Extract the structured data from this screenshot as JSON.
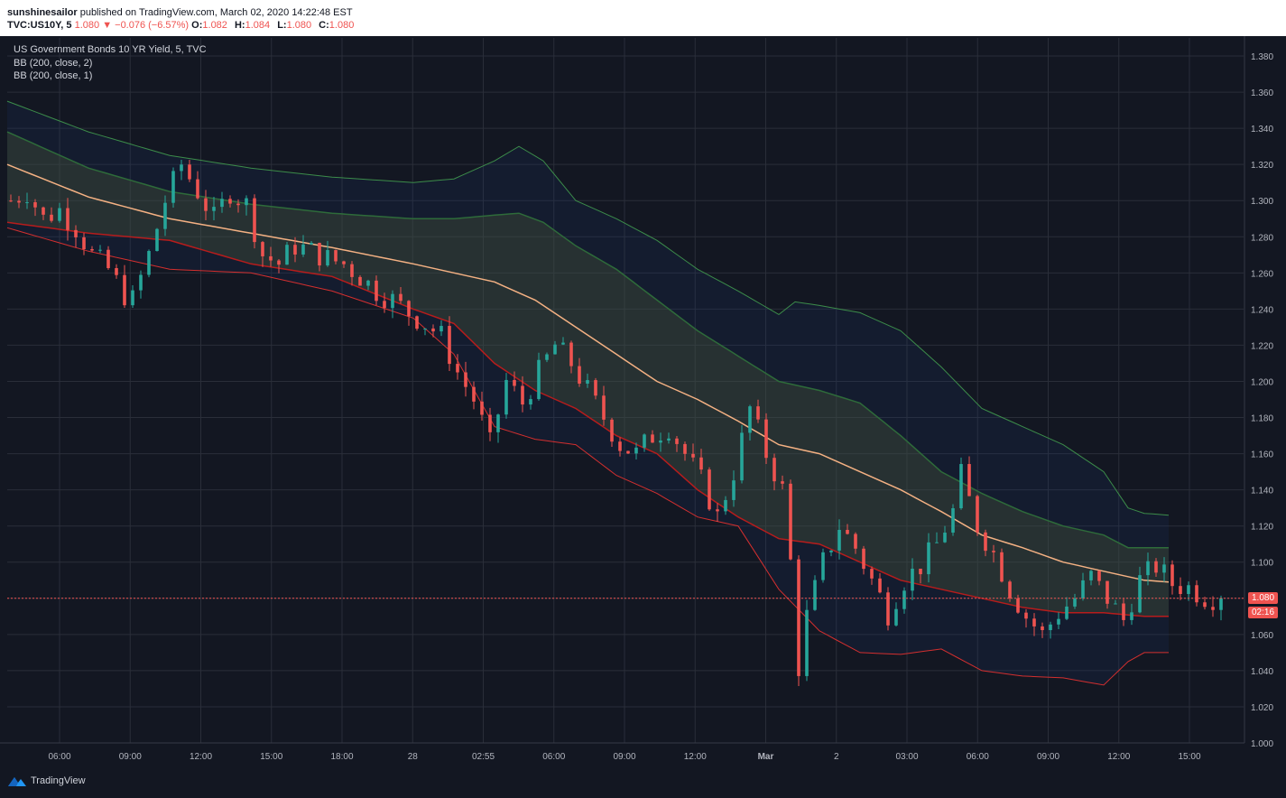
{
  "header": {
    "author": "sunshinesailor",
    "published_text": "published on TradingView.com, March 02, 2020 14:22:48 EST",
    "symbol_line": "TVC:US10Y, 5",
    "last": "1.080",
    "arrow": "▼",
    "change": "−0.076 (−6.57%)",
    "o_label": "O:",
    "o_value": "1.082",
    "h_label": "H:",
    "h_value": "1.084",
    "l_label": "L:",
    "l_value": "1.080",
    "c_label": "C:",
    "c_value": "1.080"
  },
  "legend": {
    "title": "US Government Bonds 10 YR Yield, 5, TVC",
    "bb1": "BB (200, close, 2)",
    "bb2": "BB (200, close, 1)"
  },
  "price_tag": {
    "value": "1.080",
    "countdown": "02:16"
  },
  "brand": {
    "label": "TradingView",
    "icon": "tradingview-logo-icon"
  },
  "colors": {
    "background": "#131722",
    "up": "#26a69a",
    "down": "#ef5350",
    "basis": "#f4b183",
    "upper_band": "#3c8c4a",
    "lower_band": "#d32f2f",
    "grid": "#2a2e39"
  },
  "chart_data": {
    "type": "candlestick",
    "title": "US Government Bonds 10 YR Yield, 5, TVC",
    "ylim": [
      1.0,
      1.39
    ],
    "y_ticks": [
      "1.000",
      "1.020",
      "1.040",
      "1.060",
      "1.080",
      "1.100",
      "1.120",
      "1.140",
      "1.160",
      "1.180",
      "1.200",
      "1.220",
      "1.240",
      "1.260",
      "1.280",
      "1.300",
      "1.320",
      "1.340",
      "1.360",
      "1.380"
    ],
    "x_ticks": [
      "06:00",
      "09:00",
      "12:00",
      "15:00",
      "18:00",
      "28",
      "02:55",
      "06:00",
      "09:00",
      "12:00",
      "Mar",
      "2",
      "03:00",
      "06:00",
      "09:00",
      "12:00",
      "15:00"
    ],
    "current_price": 1.08,
    "price_path": [
      [
        0,
        1.3
      ],
      [
        2,
        1.305
      ],
      [
        4,
        1.29
      ],
      [
        6,
        1.295
      ],
      [
        8,
        1.285
      ],
      [
        10,
        1.27
      ],
      [
        12,
        1.262
      ],
      [
        14,
        1.248
      ],
      [
        15,
        1.245
      ],
      [
        17,
        1.27
      ],
      [
        19,
        1.3
      ],
      [
        21,
        1.32
      ],
      [
        23,
        1.305
      ],
      [
        25,
        1.29
      ],
      [
        27,
        1.305
      ],
      [
        29,
        1.298
      ],
      [
        31,
        1.27
      ],
      [
        33,
        1.265
      ],
      [
        35,
        1.275
      ],
      [
        37,
        1.272
      ],
      [
        39,
        1.268
      ],
      [
        41,
        1.265
      ],
      [
        43,
        1.258
      ],
      [
        45,
        1.25
      ],
      [
        47,
        1.245
      ],
      [
        49,
        1.238
      ],
      [
        51,
        1.232
      ],
      [
        53,
        1.225
      ],
      [
        55,
        1.205
      ],
      [
        57,
        1.19
      ],
      [
        59,
        1.165
      ],
      [
        61,
        1.2
      ],
      [
        63,
        1.188
      ],
      [
        65,
        1.205
      ],
      [
        67,
        1.22
      ],
      [
        69,
        1.21
      ],
      [
        71,
        1.195
      ],
      [
        73,
        1.18
      ],
      [
        75,
        1.165
      ],
      [
        77,
        1.16
      ],
      [
        79,
        1.17
      ],
      [
        81,
        1.175
      ],
      [
        83,
        1.16
      ],
      [
        85,
        1.145
      ],
      [
        87,
        1.125
      ],
      [
        89,
        1.15
      ],
      [
        91,
        1.185
      ],
      [
        93,
        1.16
      ],
      [
        95,
        1.14
      ],
      [
        96,
        1.1
      ],
      [
        97,
        1.042
      ],
      [
        98,
        1.07
      ],
      [
        100,
        1.1
      ],
      [
        102,
        1.12
      ],
      [
        104,
        1.108
      ],
      [
        106,
        1.09
      ],
      [
        108,
        1.072
      ],
      [
        110,
        1.09
      ],
      [
        112,
        1.098
      ],
      [
        114,
        1.11
      ],
      [
        116,
        1.128
      ],
      [
        117,
        1.148
      ],
      [
        119,
        1.12
      ],
      [
        121,
        1.105
      ],
      [
        123,
        1.085
      ],
      [
        125,
        1.07
      ],
      [
        127,
        1.06
      ],
      [
        129,
        1.072
      ],
      [
        131,
        1.08
      ],
      [
        133,
        1.092
      ],
      [
        135,
        1.08
      ],
      [
        137,
        1.068
      ],
      [
        139,
        1.09
      ],
      [
        141,
        1.098
      ],
      [
        143,
        1.088
      ],
      [
        145,
        1.086
      ],
      [
        147,
        1.081
      ],
      [
        149,
        1.08
      ]
    ],
    "series": [
      {
        "name": "BB (200, close, 2)",
        "band": "upper",
        "values": [
          [
            0,
            1.355
          ],
          [
            10,
            1.338
          ],
          [
            20,
            1.325
          ],
          [
            30,
            1.318
          ],
          [
            40,
            1.313
          ],
          [
            50,
            1.31
          ],
          [
            55,
            1.312
          ],
          [
            60,
            1.322
          ],
          [
            63,
            1.33
          ],
          [
            66,
            1.322
          ],
          [
            70,
            1.3
          ],
          [
            75,
            1.29
          ],
          [
            80,
            1.278
          ],
          [
            85,
            1.262
          ],
          [
            90,
            1.25
          ],
          [
            95,
            1.237
          ],
          [
            97,
            1.244
          ],
          [
            100,
            1.242
          ],
          [
            105,
            1.238
          ],
          [
            110,
            1.228
          ],
          [
            115,
            1.208
          ],
          [
            120,
            1.185
          ],
          [
            125,
            1.175
          ],
          [
            130,
            1.165
          ],
          [
            135,
            1.15
          ],
          [
            138,
            1.13
          ],
          [
            140,
            1.127
          ],
          [
            143,
            1.126
          ]
        ]
      },
      {
        "name": "BB (200, close, 1)",
        "band": "upper",
        "values": [
          [
            0,
            1.338
          ],
          [
            10,
            1.318
          ],
          [
            20,
            1.305
          ],
          [
            30,
            1.298
          ],
          [
            40,
            1.293
          ],
          [
            50,
            1.29
          ],
          [
            55,
            1.29
          ],
          [
            60,
            1.292
          ],
          [
            63,
            1.293
          ],
          [
            66,
            1.288
          ],
          [
            70,
            1.275
          ],
          [
            75,
            1.262
          ],
          [
            80,
            1.245
          ],
          [
            85,
            1.228
          ],
          [
            90,
            1.214
          ],
          [
            95,
            1.2
          ],
          [
            100,
            1.195
          ],
          [
            105,
            1.188
          ],
          [
            110,
            1.17
          ],
          [
            115,
            1.15
          ],
          [
            120,
            1.138
          ],
          [
            125,
            1.128
          ],
          [
            130,
            1.12
          ],
          [
            135,
            1.115
          ],
          [
            138,
            1.108
          ],
          [
            143,
            1.108
          ]
        ]
      },
      {
        "name": "Basis",
        "band": "basis",
        "values": [
          [
            0,
            1.32
          ],
          [
            10,
            1.302
          ],
          [
            20,
            1.29
          ],
          [
            30,
            1.282
          ],
          [
            40,
            1.274
          ],
          [
            50,
            1.265
          ],
          [
            55,
            1.26
          ],
          [
            60,
            1.255
          ],
          [
            65,
            1.245
          ],
          [
            70,
            1.23
          ],
          [
            75,
            1.215
          ],
          [
            80,
            1.2
          ],
          [
            85,
            1.19
          ],
          [
            90,
            1.178
          ],
          [
            95,
            1.165
          ],
          [
            100,
            1.16
          ],
          [
            105,
            1.15
          ],
          [
            110,
            1.14
          ],
          [
            115,
            1.128
          ],
          [
            120,
            1.115
          ],
          [
            125,
            1.108
          ],
          [
            130,
            1.1
          ],
          [
            135,
            1.095
          ],
          [
            140,
            1.09
          ],
          [
            143,
            1.089
          ]
        ]
      },
      {
        "name": "BB (200, close, 1)",
        "band": "lower",
        "values": [
          [
            0,
            1.288
          ],
          [
            10,
            1.282
          ],
          [
            20,
            1.278
          ],
          [
            30,
            1.265
          ],
          [
            40,
            1.258
          ],
          [
            50,
            1.24
          ],
          [
            55,
            1.232
          ],
          [
            60,
            1.21
          ],
          [
            65,
            1.195
          ],
          [
            70,
            1.185
          ],
          [
            75,
            1.17
          ],
          [
            80,
            1.16
          ],
          [
            85,
            1.14
          ],
          [
            90,
            1.125
          ],
          [
            95,
            1.113
          ],
          [
            100,
            1.11
          ],
          [
            105,
            1.1
          ],
          [
            110,
            1.09
          ],
          [
            115,
            1.085
          ],
          [
            120,
            1.08
          ],
          [
            125,
            1.075
          ],
          [
            130,
            1.072
          ],
          [
            135,
            1.072
          ],
          [
            140,
            1.07
          ],
          [
            143,
            1.07
          ]
        ]
      },
      {
        "name": "BB (200, close, 2)",
        "band": "lower",
        "values": [
          [
            0,
            1.285
          ],
          [
            10,
            1.272
          ],
          [
            20,
            1.262
          ],
          [
            30,
            1.26
          ],
          [
            40,
            1.25
          ],
          [
            50,
            1.235
          ],
          [
            55,
            1.215
          ],
          [
            60,
            1.175
          ],
          [
            65,
            1.168
          ],
          [
            70,
            1.165
          ],
          [
            75,
            1.148
          ],
          [
            80,
            1.138
          ],
          [
            85,
            1.125
          ],
          [
            90,
            1.12
          ],
          [
            95,
            1.085
          ],
          [
            100,
            1.062
          ],
          [
            105,
            1.05
          ],
          [
            110,
            1.049
          ],
          [
            115,
            1.052
          ],
          [
            120,
            1.04
          ],
          [
            125,
            1.037
          ],
          [
            130,
            1.036
          ],
          [
            135,
            1.032
          ],
          [
            138,
            1.045
          ],
          [
            140,
            1.05
          ],
          [
            143,
            1.05
          ]
        ]
      }
    ]
  }
}
